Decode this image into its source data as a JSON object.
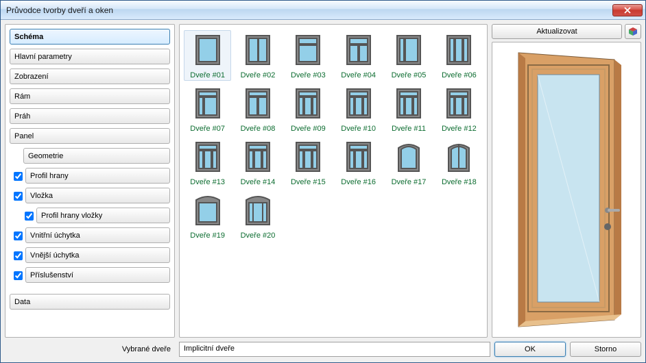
{
  "window": {
    "title": "Průvodce tvorby dveří a oken"
  },
  "sidebar": {
    "items": [
      {
        "label": "Schéma",
        "selected": true
      },
      {
        "label": "Hlavní parametry"
      },
      {
        "label": "Zobrazení"
      },
      {
        "label": "Rám"
      },
      {
        "label": "Práh"
      },
      {
        "label": "Panel"
      }
    ],
    "sub_geometrie": "Geometrie",
    "checks": [
      {
        "label": "Profil hrany",
        "checked": true,
        "sub": null
      },
      {
        "label": "Vložka",
        "checked": true,
        "sub": {
          "label": "Profil hrany vložky",
          "checked": true
        }
      },
      {
        "label": "Vnitřní úchytka",
        "checked": true,
        "sub": null
      },
      {
        "label": "Vnější úchytka",
        "checked": true,
        "sub": null
      },
      {
        "label": "Příslušenství",
        "checked": true,
        "sub": null
      }
    ],
    "data": "Data"
  },
  "gallery": {
    "items": [
      "Dveře #01",
      "Dveře #02",
      "Dveře #03",
      "Dveře #04",
      "Dveře #05",
      "Dveře #06",
      "Dveře #07",
      "Dveře #08",
      "Dveře #09",
      "Dveře #10",
      "Dveře #11",
      "Dveře #12",
      "Dveře #13",
      "Dveře #14",
      "Dveře #15",
      "Dveře #16",
      "Dveře #17",
      "Dveře #18",
      "Dveře #19",
      "Dveře #20"
    ],
    "selected_index": 0
  },
  "preview": {
    "update_label": "Aktualizovat"
  },
  "footer": {
    "selected_label": "Vybrané dveře",
    "selected_value": "Implicitní dveře",
    "ok": "OK",
    "cancel": "Storno"
  },
  "colors": {
    "glass": "#93cfe8",
    "frame_dark": "#555555",
    "frame_mid": "#888888",
    "wood": "#d9a066",
    "wood_dark": "#b87a45",
    "wood_light": "#e8c08c"
  }
}
